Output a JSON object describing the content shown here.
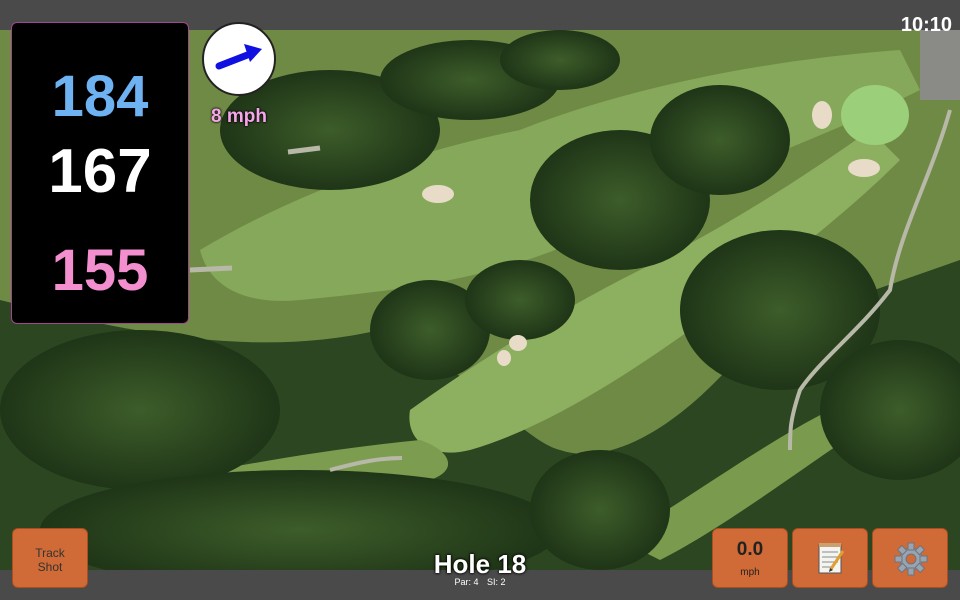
{
  "status_bar": {
    "time": "10:10"
  },
  "distances": {
    "back": "184",
    "middle": "167",
    "front": "155"
  },
  "wind": {
    "speed": "8 mph",
    "direction_icon": "wind-arrow-icon"
  },
  "hole": {
    "title": "Hole 18",
    "par": "Par: 4",
    "si": "SI: 2"
  },
  "buttons": {
    "track_shot_line1": "Track",
    "track_shot_line2": "Shot",
    "speed_value": "0.0",
    "speed_unit": "mph",
    "notes_icon": "notepad-icon",
    "settings_icon": "gear-icon"
  },
  "colors": {
    "back_distance": "#6fb2f2",
    "middle_distance": "#ffffff",
    "front_distance": "#f48fcf",
    "button": "#d06a36",
    "wind_text": "#f6a6ea",
    "arrow": "#1010e0"
  }
}
